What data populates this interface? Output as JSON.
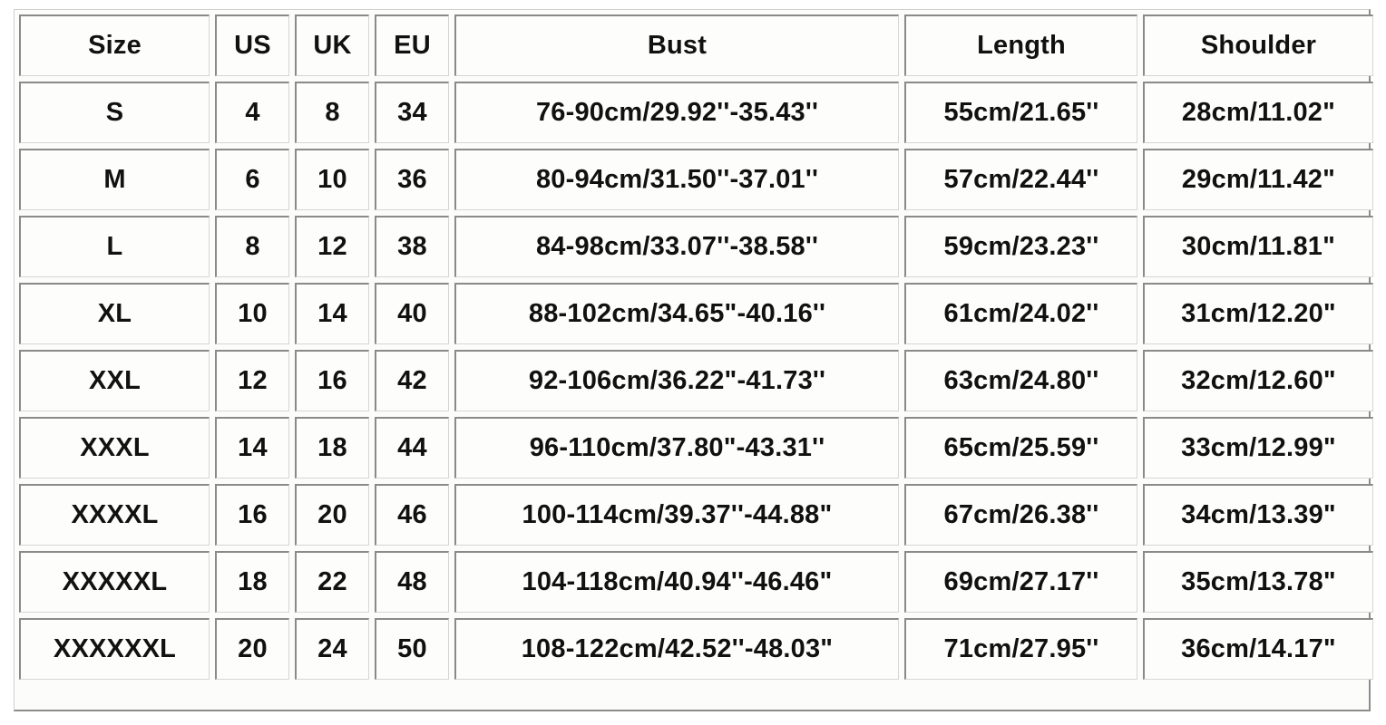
{
  "table": {
    "headers": [
      "Size",
      "US",
      "UK",
      "EU",
      "Bust",
      "Length",
      "Shoulder"
    ],
    "rows": [
      {
        "size": "S",
        "us": "4",
        "uk": "8",
        "eu": "34",
        "bust": "76-90cm/29.92''-35.43''",
        "length": "55cm/21.65''",
        "shoulder": "28cm/11.02\""
      },
      {
        "size": "M",
        "us": "6",
        "uk": "10",
        "eu": "36",
        "bust": "80-94cm/31.50''-37.01''",
        "length": "57cm/22.44''",
        "shoulder": "29cm/11.42\""
      },
      {
        "size": "L",
        "us": "8",
        "uk": "12",
        "eu": "38",
        "bust": "84-98cm/33.07''-38.58''",
        "length": "59cm/23.23''",
        "shoulder": "30cm/11.81\""
      },
      {
        "size": "XL",
        "us": "10",
        "uk": "14",
        "eu": "40",
        "bust": "88-102cm/34.65\"-40.16''",
        "length": "61cm/24.02''",
        "shoulder": "31cm/12.20\""
      },
      {
        "size": "XXL",
        "us": "12",
        "uk": "16",
        "eu": "42",
        "bust": "92-106cm/36.22\"-41.73''",
        "length": "63cm/24.80''",
        "shoulder": "32cm/12.60\""
      },
      {
        "size": "XXXL",
        "us": "14",
        "uk": "18",
        "eu": "44",
        "bust": "96-110cm/37.80\"-43.31''",
        "length": "65cm/25.59''",
        "shoulder": "33cm/12.99\""
      },
      {
        "size": "XXXXL",
        "us": "16",
        "uk": "20",
        "eu": "46",
        "bust": "100-114cm/39.37''-44.88\"",
        "length": "67cm/26.38''",
        "shoulder": "34cm/13.39\""
      },
      {
        "size": "XXXXXL",
        "us": "18",
        "uk": "22",
        "eu": "48",
        "bust": "104-118cm/40.94''-46.46\"",
        "length": "69cm/27.17''",
        "shoulder": "35cm/13.78\""
      },
      {
        "size": "XXXXXXL",
        "us": "20",
        "uk": "24",
        "eu": "50",
        "bust": "108-122cm/42.52''-48.03\"",
        "length": "71cm/27.95''",
        "shoulder": "36cm/14.17\""
      }
    ]
  },
  "colors": {
    "text": "#111111",
    "cell_border_dark": "#8a8a8a",
    "cell_border_light": "#d6d6d6",
    "background": "#fdfdfb"
  }
}
